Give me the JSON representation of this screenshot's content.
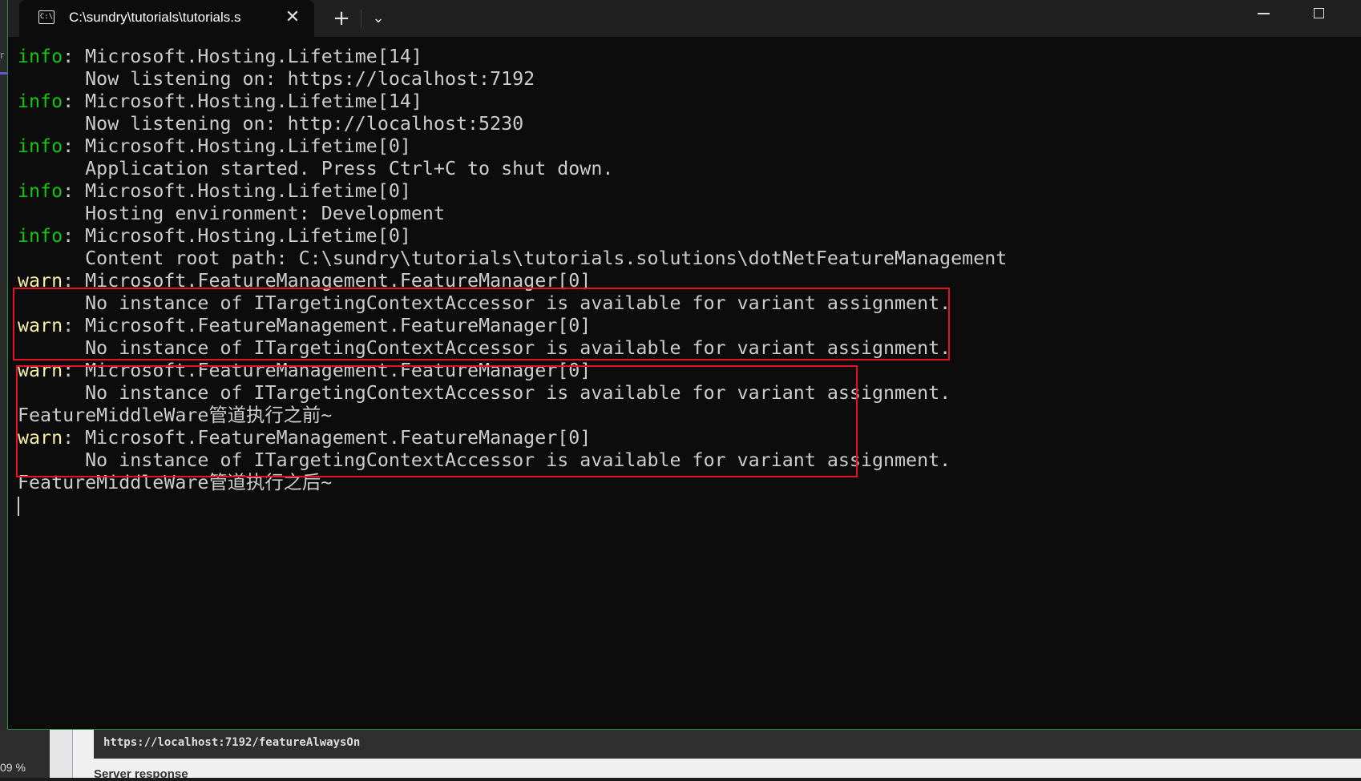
{
  "window": {
    "tab_icon_text": "C:\\",
    "tab_title": "C:\\sundry\\tutorials\\tutorials.s",
    "close_glyph": "✕",
    "new_tab_glyph": "+",
    "dropdown_glyph": "⌄"
  },
  "console": {
    "lines": [
      {
        "level": "info",
        "prefix": "info",
        "text": ": Microsoft.Hosting.Lifetime[14]"
      },
      {
        "level": "",
        "prefix": "",
        "text": "      Now listening on: https://localhost:7192"
      },
      {
        "level": "info",
        "prefix": "info",
        "text": ": Microsoft.Hosting.Lifetime[14]"
      },
      {
        "level": "",
        "prefix": "",
        "text": "      Now listening on: http://localhost:5230"
      },
      {
        "level": "info",
        "prefix": "info",
        "text": ": Microsoft.Hosting.Lifetime[0]"
      },
      {
        "level": "",
        "prefix": "",
        "text": "      Application started. Press Ctrl+C to shut down."
      },
      {
        "level": "info",
        "prefix": "info",
        "text": ": Microsoft.Hosting.Lifetime[0]"
      },
      {
        "level": "",
        "prefix": "",
        "text": "      Hosting environment: Development"
      },
      {
        "level": "info",
        "prefix": "info",
        "text": ": Microsoft.Hosting.Lifetime[0]"
      },
      {
        "level": "",
        "prefix": "",
        "text": "      Content root path: C:\\sundry\\tutorials\\tutorials.solutions\\dotNetFeatureManagement"
      },
      {
        "level": "warn",
        "prefix": "warn",
        "text": ": Microsoft.FeatureManagement.FeatureManager[0]"
      },
      {
        "level": "",
        "prefix": "",
        "text": "      No instance of ITargetingContextAccessor is available for variant assignment."
      },
      {
        "level": "warn",
        "prefix": "warn",
        "text": ": Microsoft.FeatureManagement.FeatureManager[0]"
      },
      {
        "level": "",
        "prefix": "",
        "text": "      No instance of ITargetingContextAccessor is available for variant assignment."
      },
      {
        "level": "warn",
        "prefix": "warn",
        "text": ": Microsoft.FeatureManagement.FeatureManager[0]"
      },
      {
        "level": "",
        "prefix": "",
        "text": "      No instance of ITargetingContextAccessor is available for variant assignment."
      },
      {
        "level": "",
        "prefix": "",
        "text": "FeatureMiddleWare管道执行之前~"
      },
      {
        "level": "warn",
        "prefix": "warn",
        "text": ": Microsoft.FeatureManagement.FeatureManager[0]"
      },
      {
        "level": "",
        "prefix": "",
        "text": "      No instance of ITargetingContextAccessor is available for variant assignment."
      },
      {
        "level": "",
        "prefix": "",
        "text": "FeatureMiddleWare管道执行之后~"
      }
    ]
  },
  "underlying": {
    "zoom_label": "09 %",
    "url": "https://localhost:7192/featureAlwaysOn",
    "server_response": "Server response"
  },
  "colors": {
    "info": "#16c60c",
    "warn": "#f9f1a5",
    "text": "#cccccc",
    "annotation": "#e81123"
  }
}
